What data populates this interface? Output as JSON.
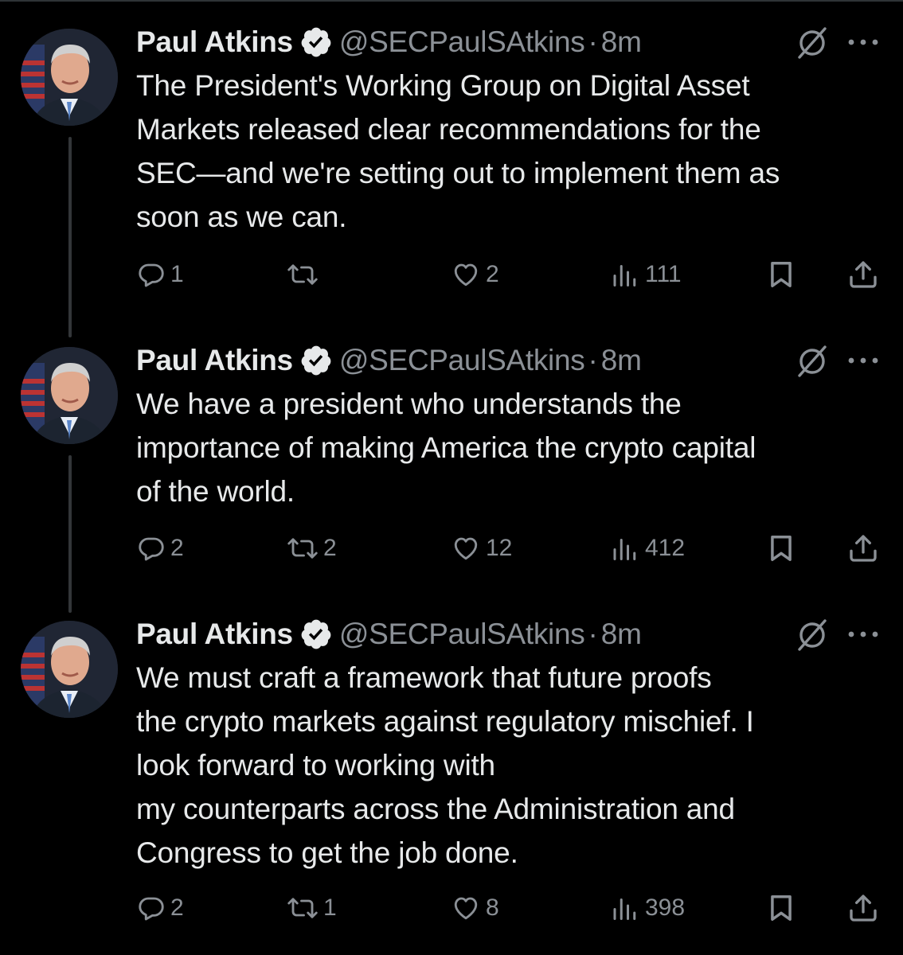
{
  "tweets": [
    {
      "author": {
        "name": "Paul Atkins",
        "handle": "@SECPaulSAtkins",
        "separator": "·",
        "time": "8m",
        "verified_color": "#1d9bf0"
      },
      "lines": [
        "The President's Working Group on Digital Asset",
        "Markets released clear recommendations for the",
        "SEC—and we're setting out to implement them as",
        "soon as we can."
      ],
      "stats": {
        "replies": "1",
        "reposts": "",
        "likes": "2",
        "views": "111"
      }
    },
    {
      "author": {
        "name": "Paul Atkins",
        "handle": "@SECPaulSAtkins",
        "separator": "·",
        "time": "8m",
        "verified_color": "#1d9bf0"
      },
      "lines": [
        "We have a president who understands the",
        "importance of making America the crypto capital",
        "of the world."
      ],
      "stats": {
        "replies": "2",
        "reposts": "2",
        "likes": "12",
        "views": "412"
      }
    },
    {
      "author": {
        "name": "Paul Atkins",
        "handle": "@SECPaulSAtkins",
        "separator": "·",
        "time": "8m",
        "verified_color": "#1d9bf0"
      },
      "lines": [
        "We must craft a framework that future proofs",
        "the crypto markets against regulatory mischief. I",
        "look forward to working with",
        "my counterparts across the Administration and",
        "Congress to get the job done."
      ],
      "stats": {
        "replies": "2",
        "reposts": "1",
        "likes": "8",
        "views": "398"
      }
    }
  ],
  "icons": {
    "reply": "reply-icon",
    "repost": "repost-icon",
    "like": "like-icon",
    "views": "views-icon",
    "bookmark": "bookmark-icon",
    "share": "share-icon",
    "grok": "grok-icon",
    "more": "more-icon"
  },
  "colors": {
    "background": "#000000",
    "text": "#e7e9ea",
    "secondary": "#8b9096",
    "thread_line": "#333639",
    "verified": "#1d9bf0"
  }
}
